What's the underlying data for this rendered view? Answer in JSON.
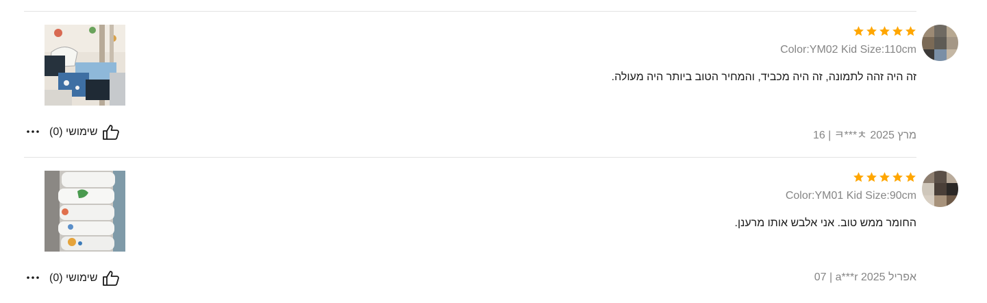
{
  "reviews": [
    {
      "rating": 5,
      "sku": "Color:YM02 Kid Size:110cm",
      "text": "זה היה זהה לתמונה, זה היה מכביד, והמחיר הטוב ביותר היה מעולה.",
      "meta": "16 | ㅋ***ㅊ מרץ 2025",
      "helpful_label": "שימושי (0)",
      "avatar_colors": [
        "#9c8a74",
        "#6f6a62",
        "#b7a891",
        "#5e5b55",
        "#3c3a38",
        "#7a8fa6"
      ],
      "photo_icon": "review-photo-clothes-pile"
    },
    {
      "rating": 5,
      "sku": "Color:YM01 Kid Size:90cm",
      "text": "החומר ממש טוב. אני אלבש אותו מרענן.",
      "meta": "07 | a***r אפריל 2025",
      "helpful_label": "שימושי (0)",
      "avatar_colors": [
        "#8d7e70",
        "#5a4f47",
        "#2b2826",
        "#cfc7bb",
        "#a7927b",
        "#6e5a48"
      ],
      "photo_icon": "review-photo-folded-shirts"
    }
  ],
  "colors": {
    "star": "#ffa600",
    "divider": "#e3e3e3",
    "muted_text": "#858585",
    "text": "#191919"
  },
  "icons": {
    "star": "star-icon",
    "helpful": "thumbs-up-icon",
    "more": "more-options-icon"
  }
}
